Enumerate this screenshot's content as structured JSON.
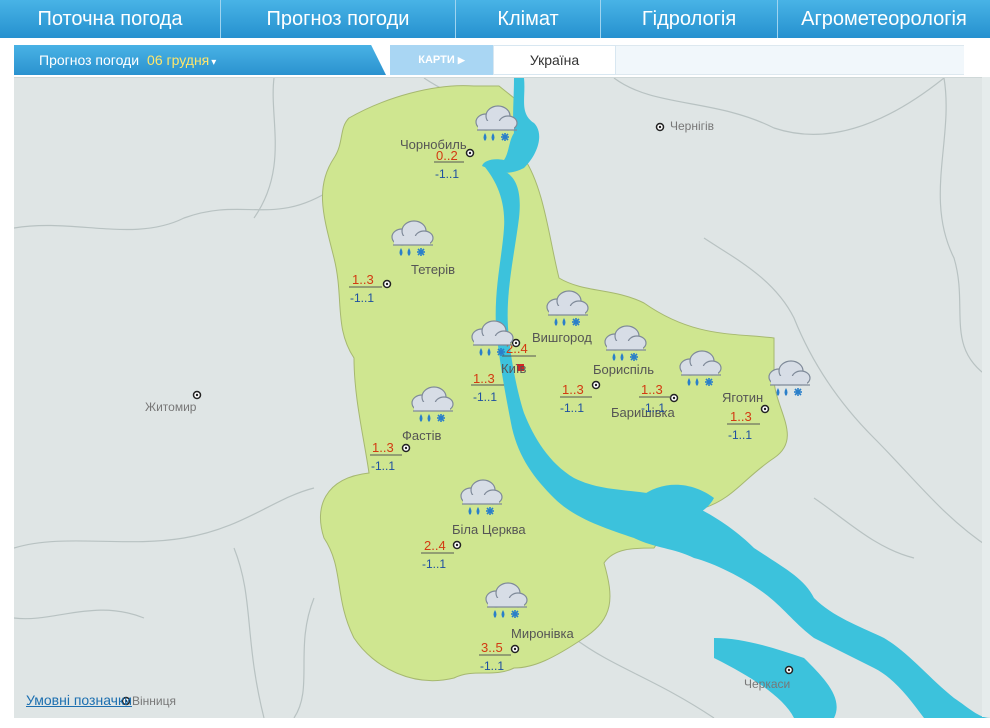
{
  "nav": {
    "tabs": [
      "Поточна погода",
      "Прогноз погоди",
      "Клімат",
      "Гідрологія",
      "Агрометеорологія"
    ]
  },
  "subnav": {
    "label": "Прогноз погоди",
    "date": "06 грудня",
    "maps": "КАРТИ",
    "region": "Україна"
  },
  "map": {
    "other_cities": [
      "Чернігів",
      "Житомир",
      "Черкаси",
      "Вінниця"
    ],
    "stations": [
      {
        "name": "Чорнобиль",
        "day": "0..2",
        "night": "-1..1",
        "icon": "rain-snow-icon"
      },
      {
        "name": "Тетерів",
        "day": "1..3",
        "night": "-1..1",
        "icon": "rain-snow-icon"
      },
      {
        "name": "Вишгород",
        "day": "2..4",
        "night": "",
        "icon": "rain-snow-icon"
      },
      {
        "name": "Київ",
        "day": "1..3",
        "night": "-1..1",
        "icon": "rain-snow-icon"
      },
      {
        "name": "Бориспіль",
        "day": "1..3",
        "night": "-1..1",
        "icon": "rain-snow-icon"
      },
      {
        "name": "Баришівка",
        "day": "1..3",
        "night": "-1..1",
        "icon": "rain-snow-icon"
      },
      {
        "name": "Яготин",
        "day": "1..3",
        "night": "-1..1",
        "icon": "rain-snow-icon"
      },
      {
        "name": "Фастів",
        "day": "1..3",
        "night": "-1..1",
        "icon": "rain-snow-icon"
      },
      {
        "name": "Біла Церква",
        "day": "2..4",
        "night": "-1..1",
        "icon": "rain-snow-icon"
      },
      {
        "name": "Миронівка",
        "day": "3..5",
        "night": "-1..1",
        "icon": "rain-snow-icon"
      }
    ],
    "colors": {
      "region": "#cfe690",
      "water": "#3cc2dc",
      "background": "#dfe5e5",
      "day_temp": "#d23a12",
      "night_temp": "#1d4fa0"
    }
  },
  "legend_link": "Умовні позначки"
}
